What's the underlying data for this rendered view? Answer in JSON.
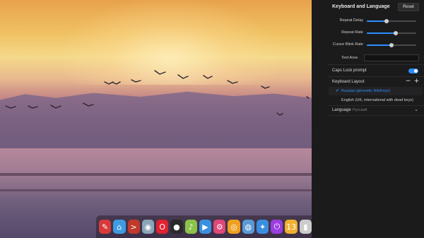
{
  "settings": {
    "title": "Keyboard and Language",
    "reset_label": "Reset",
    "repeat_delay": {
      "label": "Repeat Delay",
      "value": 0.4
    },
    "repeat_rate": {
      "label": "Repeat Rate",
      "value": 0.58
    },
    "cursor_blink_rate": {
      "label": "Cursor Blink Rate",
      "value": 0.5
    },
    "test_area": {
      "label": "Test Area",
      "value": ""
    },
    "caps_lock": {
      "label": "Caps Lock prompt",
      "enabled": true
    },
    "keyboard_layout": {
      "label": "Keyboard Layout",
      "add_label": "+",
      "remove_label": "−",
      "items": [
        {
          "label": "Russian (phonetic WinKeys)",
          "selected": true,
          "check": "✔"
        },
        {
          "label": "English (UK, international with dead keys)",
          "selected": false
        }
      ]
    },
    "language": {
      "label": "Language",
      "value": "Русский",
      "chevron": "⌄"
    }
  },
  "nav_icons": [
    "home-icon",
    "account-icon",
    "display-icon",
    "calendar-icon",
    "appearance-icon",
    "network-icon",
    "sound-icon",
    "time-icon",
    "power-icon",
    "mouse-icon",
    "keyboard-icon",
    "update-icon",
    "info-icon",
    "shutdown-icon"
  ],
  "dock": [
    {
      "name": "launcher-icon",
      "glyph": "✎",
      "color": "#d83a3a"
    },
    {
      "name": "file-manager-icon",
      "glyph": "⌂",
      "color": "#3f9be0"
    },
    {
      "name": "terminal-icon",
      "glyph": ">",
      "color": "#c0392b"
    },
    {
      "name": "browser-icon",
      "glyph": "◉",
      "color": "#8aa6b8"
    },
    {
      "name": "opera-icon",
      "glyph": "O",
      "color": "#e02231"
    },
    {
      "name": "app-icon",
      "glyph": "●",
      "color": "#2a2a2a"
    },
    {
      "name": "music-icon",
      "glyph": "♪",
      "color": "#8bc34a"
    },
    {
      "name": "video-icon",
      "glyph": "▶",
      "color": "#3b8fe0"
    },
    {
      "name": "settings-icon",
      "glyph": "⚙",
      "color": "#e0487a"
    },
    {
      "name": "sync-icon",
      "glyph": "◎",
      "color": "#f0a020"
    },
    {
      "name": "globe-icon",
      "glyph": "◍",
      "color": "#5a9bd5"
    },
    {
      "name": "apps-icon",
      "glyph": "✦",
      "color": "#3a8ee0"
    },
    {
      "name": "power-icon",
      "glyph": "⏻",
      "color": "#9b3de0"
    },
    {
      "name": "calendar-icon",
      "glyph": "13",
      "color": "#f0b030"
    },
    {
      "name": "trash-icon",
      "glyph": "▮",
      "color": "#cccccc"
    }
  ]
}
